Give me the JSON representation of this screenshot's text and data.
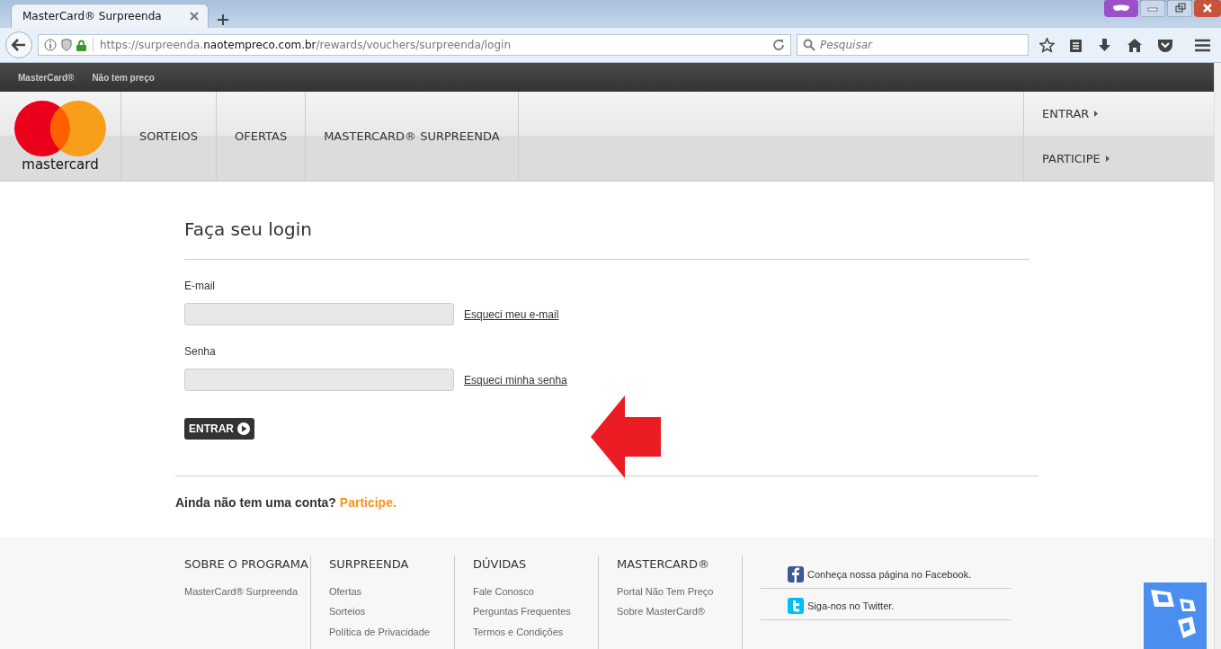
{
  "browser": {
    "tab_title": "MasterCard® Surpreenda",
    "url": {
      "start": "https://surpreenda.",
      "domain": "naotempreco.com.br",
      "path": "/rewards/vouchers/surpreenda/login"
    },
    "search_placeholder": "Pesquisar"
  },
  "top_links": [
    "MasterCard®",
    "Não tem preço"
  ],
  "header": {
    "logo_text": "mastercard",
    "nav_items": [
      "SORTEIOS",
      "OFERTAS",
      "MASTERCARD® SURPREENDA"
    ],
    "account_links": [
      "ENTRAR",
      "PARTICIPE"
    ]
  },
  "login": {
    "title": "Faça seu login",
    "fields": [
      {
        "label": "E-mail",
        "link": "Esqueci meu e-mail"
      },
      {
        "label": "Senha",
        "link": "Esqueci minha senha"
      }
    ],
    "submit": "ENTRAR",
    "signup": {
      "question": "Ainda não tem uma conta?",
      "link": "Participe."
    }
  },
  "footer": {
    "columns": [
      {
        "heading": "SOBRE O PROGRAMA",
        "links": [
          "MasterCard® Surpreenda"
        ]
      },
      {
        "heading": "SURPREENDA",
        "links": [
          "Ofertas",
          "Sorteios",
          "Política de Privacidade"
        ]
      },
      {
        "heading": "DÚVIDAS",
        "links": [
          "Fale Conosco",
          "Perguntas Frequentes",
          "Termos e Condições"
        ]
      },
      {
        "heading": "MASTERCARD®",
        "links": [
          "Portal Não Tem Preço",
          "Sobre MasterCard®"
        ]
      }
    ],
    "social": [
      {
        "kind": "facebook",
        "text": "Conheça nossa página no Facebook."
      },
      {
        "kind": "twitter",
        "text": "Siga-nos no Twitter."
      }
    ]
  }
}
